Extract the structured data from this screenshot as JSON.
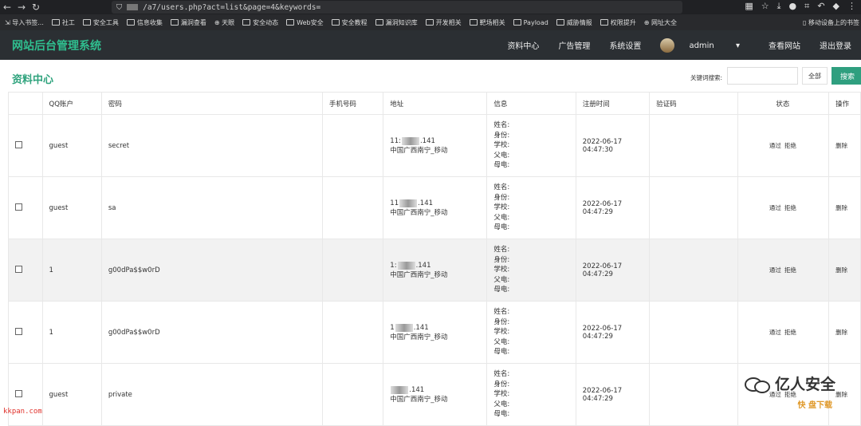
{
  "browser": {
    "url": "/a7/users.php?act=list&page=4&keywords=",
    "bookmarks": [
      "导入书签...",
      "社工",
      "安全工具",
      "信息收集",
      "漏洞查看",
      "天眼",
      "安全动态",
      "Web安全",
      "安全教程",
      "漏洞知识库",
      "开发相关",
      "靶场相关",
      "Payload",
      "威胁情报",
      "权限提升",
      "网址大全"
    ],
    "bookmark_right": "移动设备上的书签"
  },
  "app": {
    "brand": "网站后台管理系统",
    "nav": [
      "资料中心",
      "广告管理",
      "系统设置"
    ],
    "user": "admin",
    "view_site": "查看网站",
    "logout": "退出登录"
  },
  "section": {
    "title": "资料中心",
    "keyword_label": "关键词搜索:",
    "all_button": "全部",
    "search_button": "搜索"
  },
  "table": {
    "headers": [
      "",
      "QQ账户",
      "密码",
      "手机号码",
      "地址",
      "信息",
      "注册时间",
      "验证码",
      "状态",
      "操作"
    ],
    "info_labels": [
      "姓名:",
      "身份:",
      "学校:",
      "父电:",
      "母电:"
    ],
    "actions": {
      "approve": "通过",
      "reject": "拒绝",
      "delete": "删除"
    },
    "rows": [
      {
        "qq": "guest",
        "password": "secret",
        "phone": "",
        "ip_head": "11:",
        "ip_tail": ".141",
        "location": "中国广西南宁_移动",
        "reg_date": "2022-06-17",
        "reg_time": "04:47:30",
        "captcha": ""
      },
      {
        "qq": "guest",
        "password": "sa",
        "phone": "",
        "ip_head": "11",
        "ip_tail": ".141",
        "location": "中国广西南宁_移动",
        "reg_date": "2022-06-17",
        "reg_time": "04:47:29",
        "captcha": ""
      },
      {
        "qq": "1",
        "password": "g00dPa$$w0rD",
        "phone": "",
        "ip_head": "1:",
        "ip_tail": ".141",
        "location": "中国广西南宁_移动",
        "reg_date": "2022-06-17",
        "reg_time": "04:47:29",
        "captcha": ""
      },
      {
        "qq": "1",
        "password": "g00dPa$$w0rD",
        "phone": "",
        "ip_head": "1",
        "ip_tail": ".141",
        "location": "中国广西南宁_移动",
        "reg_date": "2022-06-17",
        "reg_time": "04:47:29",
        "captcha": ""
      },
      {
        "qq": "guest",
        "password": "private",
        "phone": "",
        "ip_head": "",
        "ip_tail": ".141",
        "location": "中国广西南宁_移动",
        "reg_date": "2022-06-17",
        "reg_time": "04:47:29",
        "captcha": ""
      }
    ]
  },
  "watermark": {
    "text": "亿人安全",
    "small": "快 盘下载"
  },
  "site_mark": "kkpan.com",
  "colors": {
    "brand": "#2fbf8f",
    "accent": "#2f9f7f",
    "header_bg": "#2b2f33"
  }
}
